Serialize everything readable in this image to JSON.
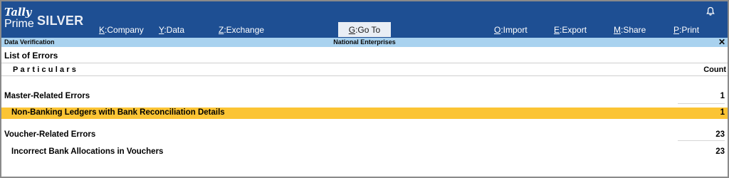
{
  "header": {
    "logo_tally": "Tally",
    "logo_prime": "Prime",
    "logo_edition": "SILVER",
    "bell_icon": "bell-icon",
    "menu": [
      {
        "key": "K",
        "label": ":Company"
      },
      {
        "key": "Y",
        "label": ":Data"
      },
      {
        "key": "Z",
        "label": ":Exchange"
      },
      {
        "key": "G",
        "label": ":Go To"
      },
      {
        "key": "O",
        "label": ":Import"
      },
      {
        "key": "E",
        "label": ":Export"
      },
      {
        "key": "M",
        "label": ":Share"
      },
      {
        "key": "P",
        "label": ":Print"
      }
    ]
  },
  "subheader": {
    "screen_name": "Data Verification",
    "company": "National Enterprises",
    "close_symbol": "✕"
  },
  "report": {
    "title": "List of Errors",
    "col_particulars": "Particulars",
    "col_count": "Count",
    "rows": [
      {
        "label": "Master-Related Errors",
        "count": "1"
      },
      {
        "label": "Non-Banking Ledgers with Bank Reconciliation Details",
        "count": "1"
      },
      {
        "label": "Voucher-Related Errors",
        "count": "23"
      },
      {
        "label": "Incorrect Bank Allocations in Vouchers",
        "count": "23"
      }
    ]
  },
  "colors": {
    "header_bg": "#1e4f93",
    "subheader_bg": "#a9d2ef",
    "highlight_row": "#fbc434"
  }
}
